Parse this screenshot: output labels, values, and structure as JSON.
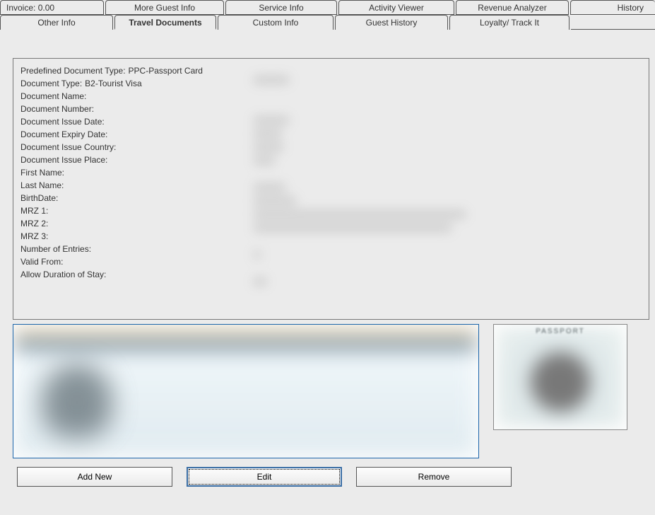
{
  "tabs_row1": {
    "invoice": "Invoice: 0.00",
    "more_guest": "More Guest Info",
    "service": "Service Info",
    "activity": "Activity Viewer",
    "revenue": "Revenue Analyzer",
    "history": "History"
  },
  "tabs_row2": {
    "other": "Other Info",
    "travel": "Travel Documents",
    "custom": "Custom Info",
    "guest_history": "Guest History",
    "loyalty": "Loyalty/ Track It"
  },
  "fields": {
    "predef_type_label": "Predefined Document Type:",
    "predef_type_value": "PPC-Passport Card",
    "doc_type_label": "Document Type:",
    "doc_type_value": "B2-Tourist Visa",
    "doc_name_label": "Document Name:",
    "doc_name_value": "",
    "doc_number_label": "Document Number:",
    "doc_number_value": "",
    "issue_date_label": "Document Issue Date:",
    "issue_date_value": "",
    "expiry_date_label": "Document Expiry Date:",
    "expiry_date_value": "",
    "issue_country_label": "Document Issue Country:",
    "issue_country_value": "",
    "issue_place_label": "Document Issue Place:",
    "issue_place_value": "",
    "first_name_label": "First Name:",
    "first_name_value": "",
    "last_name_label": "Last Name:",
    "last_name_value": "",
    "birth_label": "BirthDate:",
    "birth_value": "",
    "mrz1_label": "MRZ 1:",
    "mrz1_value": "",
    "mrz2_label": "MRZ 2:",
    "mrz2_value": "",
    "mrz3_label": "MRZ 3:",
    "mrz3_value": "",
    "num_entries_label": "Number of Entries:",
    "num_entries_value": "",
    "valid_from_label": "Valid From:",
    "valid_from_value": "",
    "allow_duration_label": "Allow Duration of Stay:",
    "allow_duration_value": ""
  },
  "thumbnail_caption": "PASSPORT",
  "buttons": {
    "add_new": "Add New",
    "edit": "Edit",
    "remove": "Remove"
  }
}
